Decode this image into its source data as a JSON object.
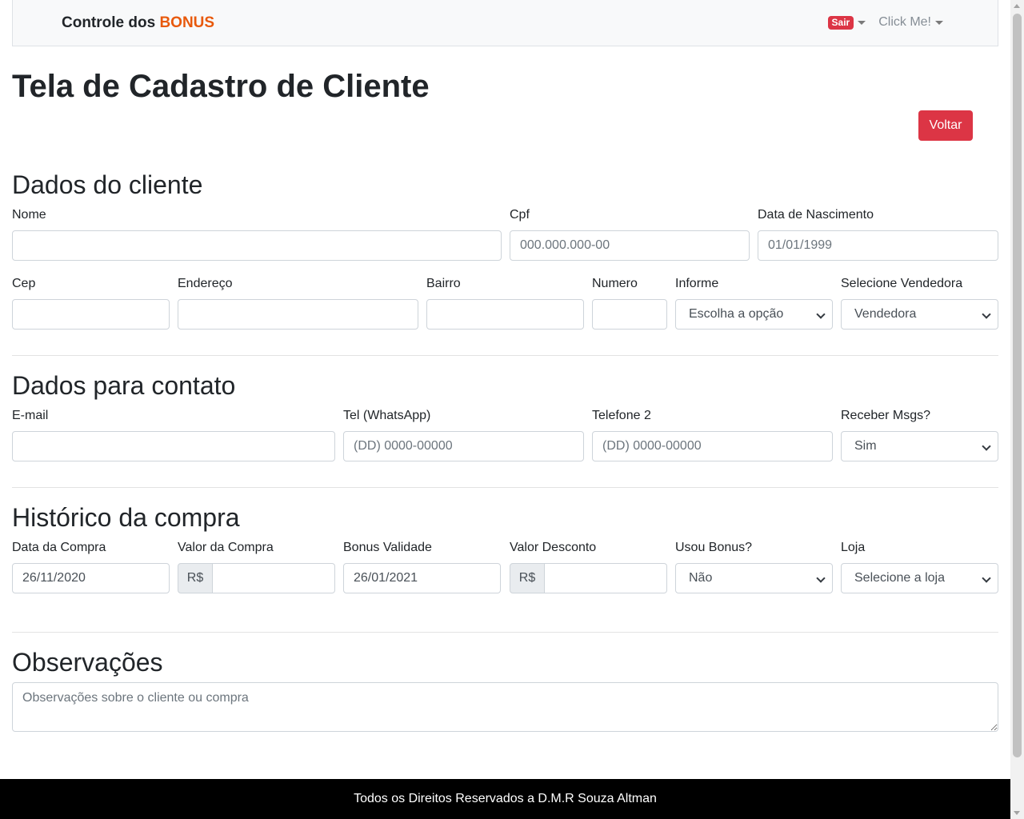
{
  "navbar": {
    "brand_prefix": "Controle dos",
    "brand_accent": "BONUS",
    "badge": "Sair",
    "link": "Click Me!"
  },
  "page_title": "Tela de Cadastro de Cliente",
  "back_button": "Voltar",
  "section_client": {
    "title": "Dados do cliente",
    "nome_label": "Nome",
    "cpf_label": "Cpf",
    "cpf_placeholder": "000.000.000-00",
    "nasc_label": "Data de Nascimento",
    "nasc_placeholder": "01/01/1999",
    "cep_label": "Cep",
    "endereco_label": "Endereço",
    "bairro_label": "Bairro",
    "numero_label": "Numero",
    "informe_label": "Informe",
    "informe_value": "Escolha a opção",
    "vendedora_label": "Selecione Vendedora",
    "vendedora_value": "Vendedora"
  },
  "section_contact": {
    "title": "Dados para contato",
    "email_label": "E-mail",
    "tel_label": "Tel (WhatsApp)",
    "tel_placeholder": "(DD) 0000-00000",
    "tel2_label": "Telefone 2",
    "tel2_placeholder": "(DD) 0000-00000",
    "msgs_label": "Receber Msgs?",
    "msgs_value": "Sim"
  },
  "section_purchase": {
    "title": "Histórico da compra",
    "data_label": "Data da Compra",
    "data_value": "26/11/2020",
    "valor_label": "Valor da Compra",
    "currency": "R$",
    "bonus_label": "Bonus Validade",
    "bonus_value": "26/01/2021",
    "desconto_label": "Valor Desconto",
    "usou_label": "Usou Bonus?",
    "usou_value": "Não",
    "loja_label": "Loja",
    "loja_value": "Selecione a loja"
  },
  "section_obs": {
    "title": "Observações",
    "placeholder": "Observações sobre o cliente ou compra"
  },
  "footer": "Todos os Direitos Reservados a D.M.R Souza Altman"
}
